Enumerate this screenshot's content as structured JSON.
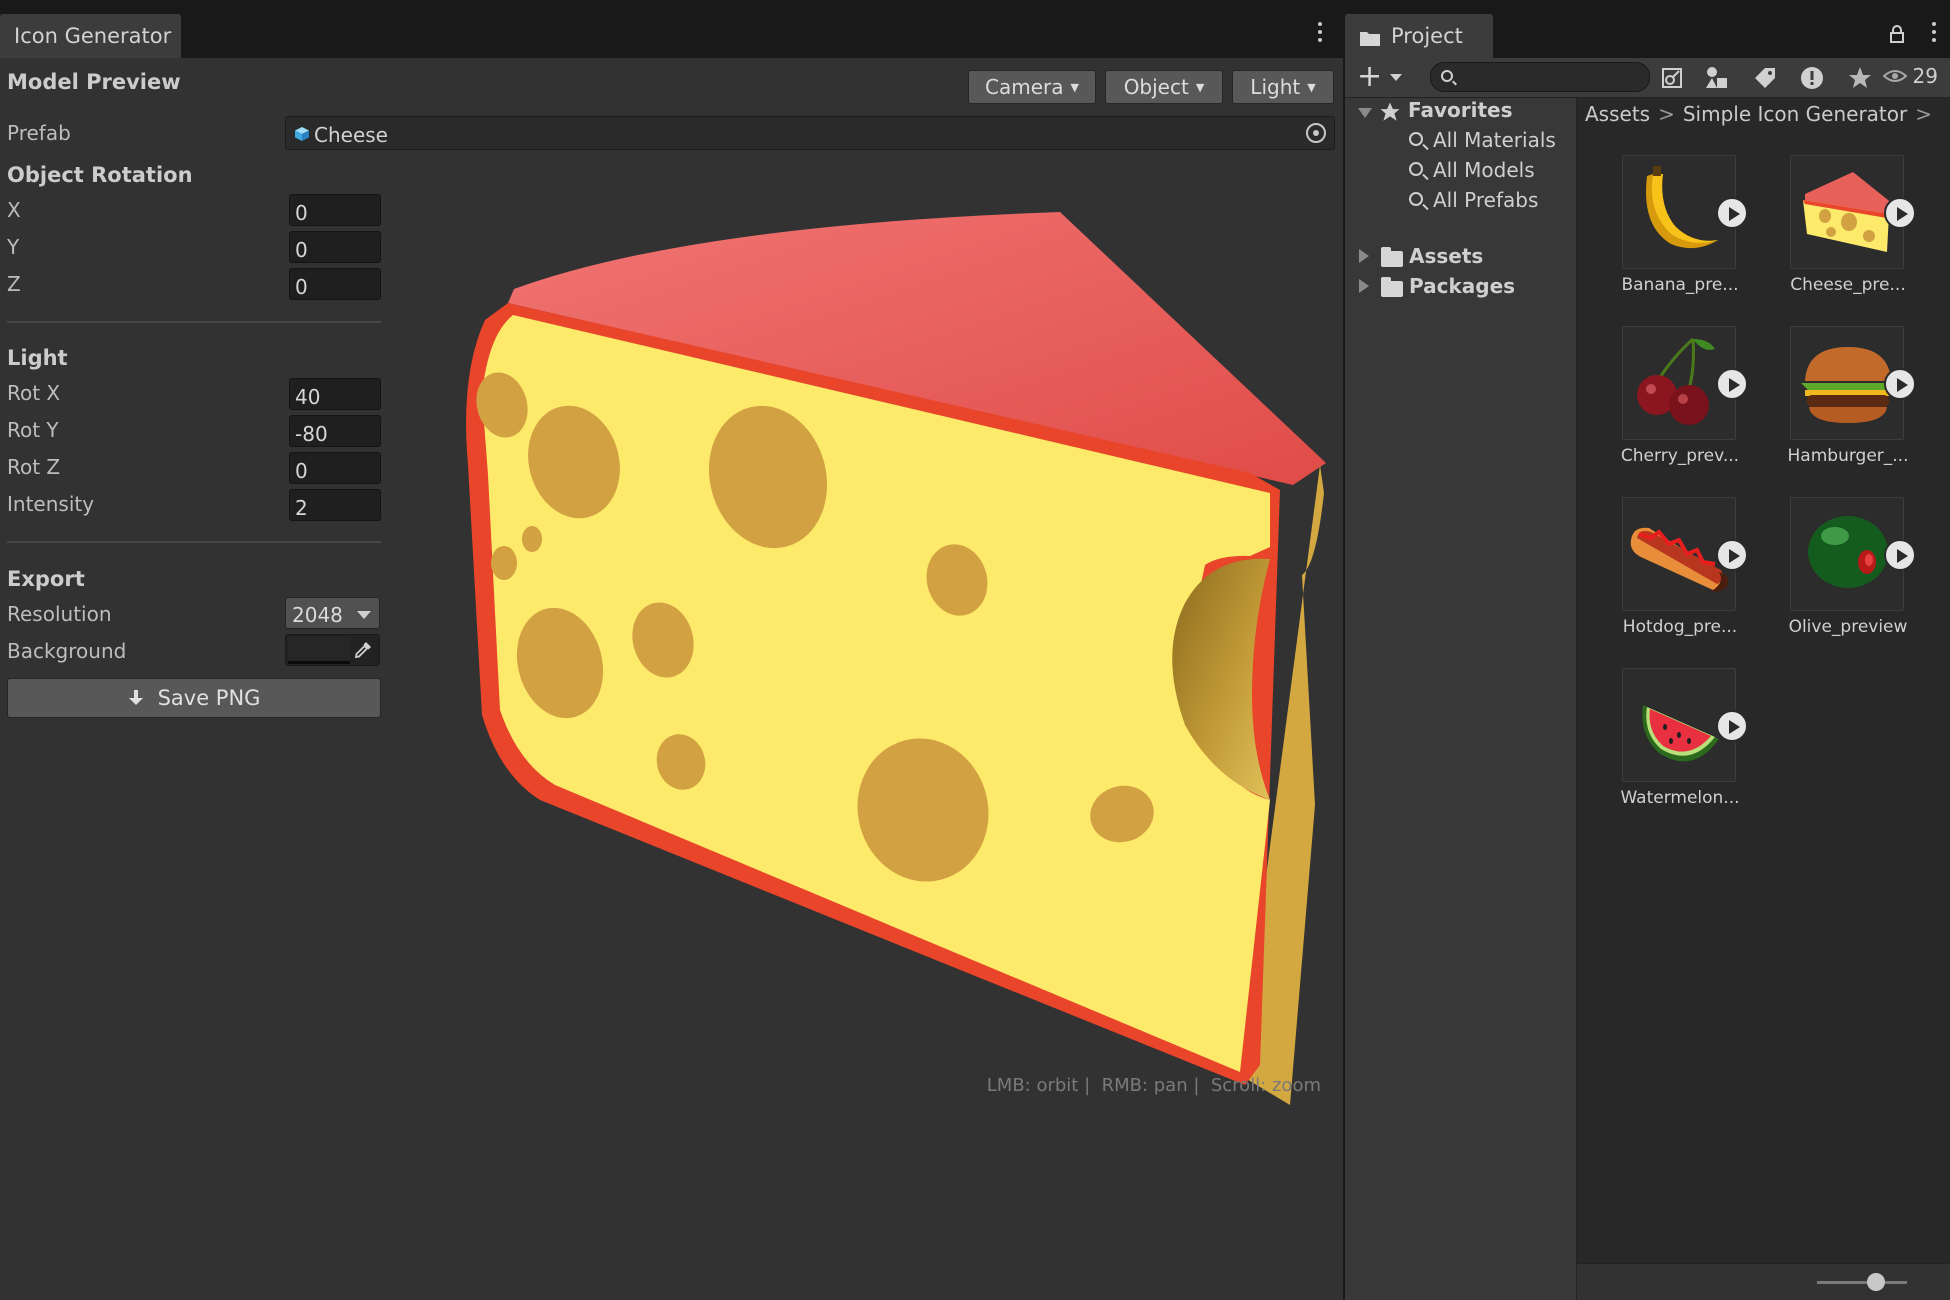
{
  "icon_generator": {
    "tab_title": "Icon Generator",
    "model_preview_title": "Model Preview",
    "toolbar": {
      "camera": "Camera",
      "object": "Object",
      "light": "Light"
    },
    "prefab": {
      "label": "Prefab",
      "value": "Cheese"
    },
    "object_rotation": {
      "title": "Object Rotation",
      "x_label": "X",
      "x_value": "0",
      "y_label": "Y",
      "y_value": "0",
      "z_label": "Z",
      "z_value": "0"
    },
    "light": {
      "title": "Light",
      "rot_x_label": "Rot X",
      "rot_x_value": "40",
      "rot_y_label": "Rot Y",
      "rot_y_value": "-80",
      "rot_z_label": "Rot Z",
      "rot_z_value": "0",
      "intensity_label": "Intensity",
      "intensity_value": "2"
    },
    "export": {
      "title": "Export",
      "resolution_label": "Resolution",
      "resolution_value": "2048",
      "background_label": "Background",
      "background_color": "#262626",
      "save_label": "Save PNG"
    },
    "viewport_hint": "LMB: orbit |  RMB: pan |  Scroll: zoom",
    "preview_colors": {
      "rind": "#e8452a",
      "top": "#e8605a",
      "cheese": "#fde96a",
      "holes": "#d2a142"
    }
  },
  "project": {
    "tab_title": "Project",
    "hidden_count": "29",
    "favorites": {
      "title": "Favorites",
      "items": [
        "All Materials",
        "All Models",
        "All Prefabs"
      ]
    },
    "tree_roots": [
      "Assets",
      "Packages"
    ],
    "breadcrumb": [
      "Assets",
      "Simple Icon Generator"
    ],
    "assets": [
      {
        "label": "Banana_pre...",
        "icon": "banana-icon"
      },
      {
        "label": "Cheese_pre...",
        "icon": "cheese-icon"
      },
      {
        "label": "Cherry_prev...",
        "icon": "cherry-icon"
      },
      {
        "label": "Hamburger_...",
        "icon": "hamburger-icon"
      },
      {
        "label": "Hotdog_pre...",
        "icon": "hotdog-icon"
      },
      {
        "label": "Olive_preview",
        "icon": "olive-icon"
      },
      {
        "label": "Watermelon...",
        "icon": "watermelon-icon"
      }
    ]
  }
}
